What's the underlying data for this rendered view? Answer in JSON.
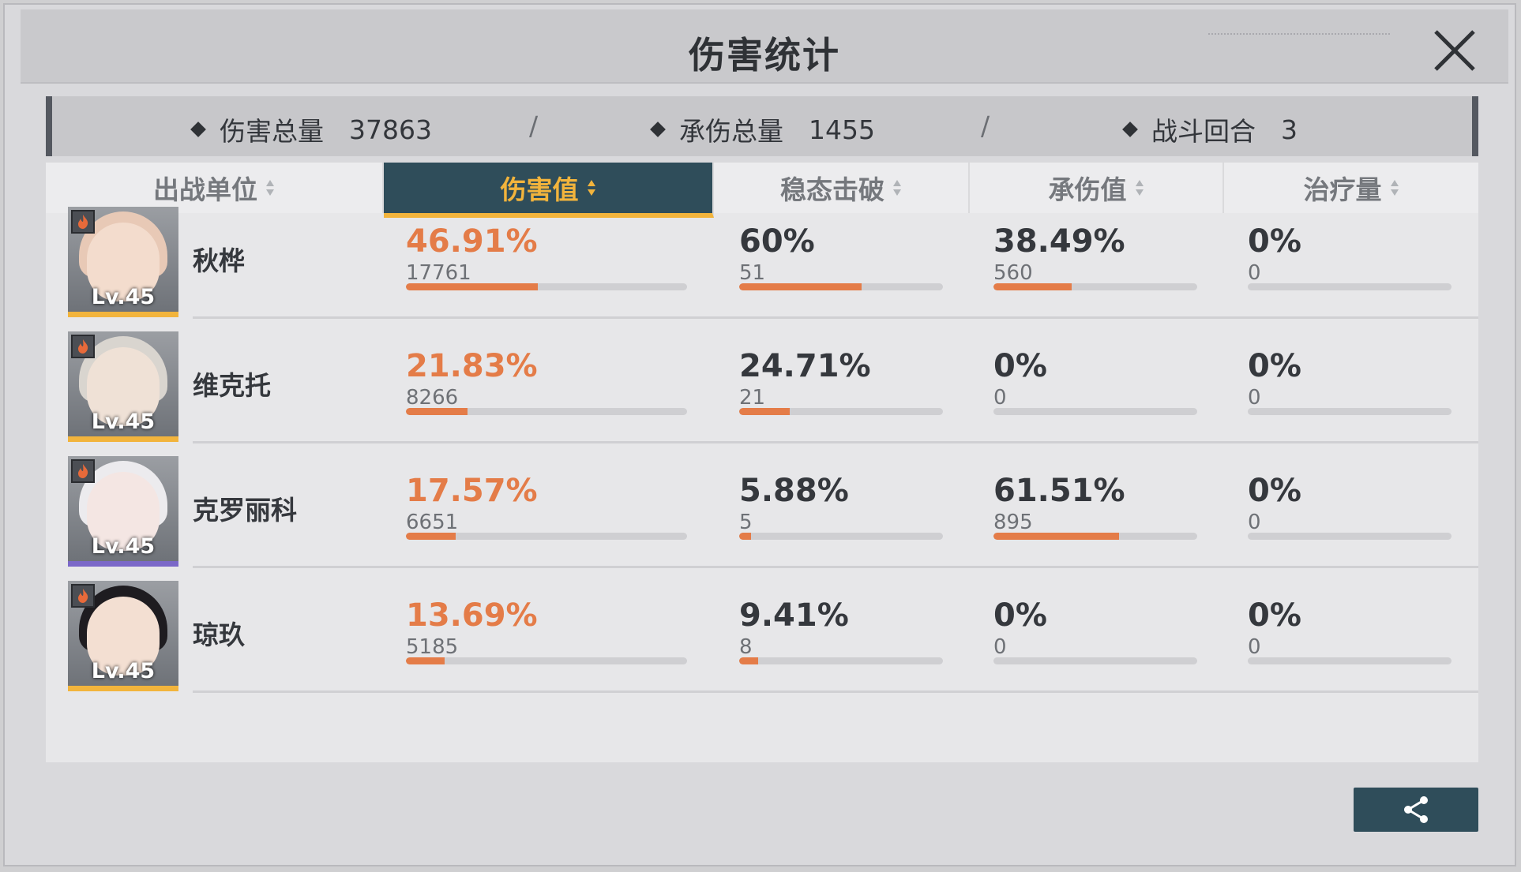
{
  "title": "伤害统计",
  "summary": {
    "total_damage_label": "伤害总量",
    "total_damage_value": "37863",
    "damage_taken_label": "承伤总量",
    "damage_taken_value": "1455",
    "rounds_label": "战斗回合",
    "rounds_value": "3",
    "separator": "/"
  },
  "tabs": [
    {
      "label": "出战单位",
      "active": false
    },
    {
      "label": "伤害值",
      "active": true
    },
    {
      "label": "稳态击破",
      "active": false
    },
    {
      "label": "承伤值",
      "active": false
    },
    {
      "label": "治疗量",
      "active": false
    }
  ],
  "rows": [
    {
      "name": "秋桦",
      "level": "Lv.45",
      "rarity_color": "#f2b43c",
      "hair_color": "#e8c9b6",
      "face_color": "#f3dccd",
      "damage": {
        "pct": "46.91%",
        "value": "17761",
        "fill": 0.4691
      },
      "break": {
        "pct": "60%",
        "value": "51",
        "fill": 0.6
      },
      "taken": {
        "pct": "38.49%",
        "value": "560",
        "fill": 0.3849
      },
      "heal": {
        "pct": "0%",
        "value": "0",
        "fill": 0
      }
    },
    {
      "name": "维克托",
      "level": "Lv.45",
      "rarity_color": "#f2b43c",
      "hair_color": "#d9d5cf",
      "face_color": "#efe1d6",
      "damage": {
        "pct": "21.83%",
        "value": "8266",
        "fill": 0.2183
      },
      "break": {
        "pct": "24.71%",
        "value": "21",
        "fill": 0.2471
      },
      "taken": {
        "pct": "0%",
        "value": "0",
        "fill": 0
      },
      "heal": {
        "pct": "0%",
        "value": "0",
        "fill": 0
      }
    },
    {
      "name": "克罗丽科",
      "level": "Lv.45",
      "rarity_color": "#7b68c8",
      "hair_color": "#ecebee",
      "face_color": "#f4e6e3",
      "damage": {
        "pct": "17.57%",
        "value": "6651",
        "fill": 0.1757
      },
      "break": {
        "pct": "5.88%",
        "value": "5",
        "fill": 0.0588
      },
      "taken": {
        "pct": "61.51%",
        "value": "895",
        "fill": 0.6151
      },
      "heal": {
        "pct": "0%",
        "value": "0",
        "fill": 0
      }
    },
    {
      "name": "琼玖",
      "level": "Lv.45",
      "rarity_color": "#f2b43c",
      "hair_color": "#1e1c20",
      "face_color": "#f3dfd2",
      "damage": {
        "pct": "13.69%",
        "value": "5185",
        "fill": 0.1369
      },
      "break": {
        "pct": "9.41%",
        "value": "8",
        "fill": 0.0941
      },
      "taken": {
        "pct": "0%",
        "value": "0",
        "fill": 0
      },
      "heal": {
        "pct": "0%",
        "value": "0",
        "fill": 0
      }
    }
  ],
  "colors": {
    "accent": "#f2b43c",
    "highlight": "#e47c48",
    "active_tab_bg": "#2f4d5a"
  },
  "icons": {
    "close": "close-icon",
    "share": "share-icon",
    "element": "fire-icon",
    "sort": "sort-icon"
  }
}
